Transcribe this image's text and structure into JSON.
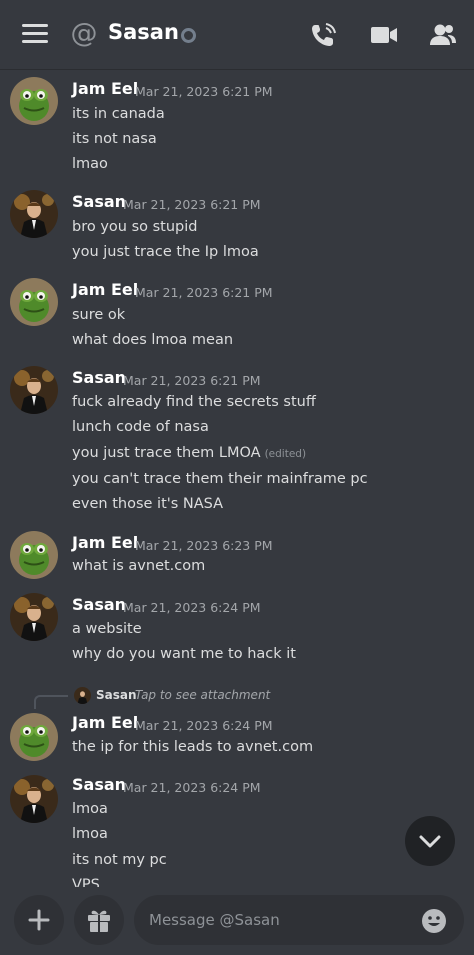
{
  "header": {
    "title": "Sasan",
    "at_symbol": "@"
  },
  "icons": {
    "menu": "hamburger-menu-icon",
    "dm": "at-sign-icon",
    "status": "offline-status-icon",
    "call": "phone-call-icon",
    "video": "video-camera-icon",
    "members": "members-icon",
    "scroll": "chevron-down-icon",
    "add": "plus-icon",
    "gift": "gift-icon",
    "emoji": "emoji-icon"
  },
  "colors": {
    "background": "#36393f",
    "input_bg": "#2f3136",
    "status_offline": "#747f8d",
    "text": "#dcddde",
    "muted": "#a3a6aa"
  },
  "messages": [
    {
      "author": "Jam Eel",
      "avatar": "kermit",
      "timestamp": "Mar 21, 2023 6:21 PM",
      "lines": [
        "its in canada",
        "its not nasa",
        "lmao"
      ]
    },
    {
      "author": "Sasan",
      "avatar": "gatsby",
      "timestamp": "Mar 21, 2023 6:21 PM",
      "lines": [
        "bro you so stupid",
        "you just trace the Ip lmoa"
      ]
    },
    {
      "author": "Jam Eel",
      "avatar": "kermit",
      "timestamp": "Mar 21, 2023 6:21 PM",
      "lines": [
        "sure ok",
        "what does lmoa mean"
      ]
    },
    {
      "author": "Sasan",
      "avatar": "gatsby",
      "timestamp": "Mar 21, 2023 6:21 PM",
      "lines": [
        "fuck already find the secrets stuff",
        "lunch code of nasa",
        "you just trace them LMOA",
        "you can't trace them their mainframe pc",
        "even those it's NASA"
      ],
      "edited_label": "(edited)"
    },
    {
      "author": "Jam Eel",
      "avatar": "kermit",
      "timestamp": "Mar 21, 2023 6:23 PM",
      "lines": [
        "what is avnet.com"
      ]
    },
    {
      "author": "Sasan",
      "avatar": "gatsby",
      "timestamp": "Mar 21, 2023 6:24 PM",
      "lines": [
        "a website",
        "why do you want me to hack it"
      ]
    },
    {
      "author": "Jam Eel",
      "avatar": "kermit",
      "timestamp": "Mar 21, 2023 6:24 PM",
      "lines": [
        "the ip for this leads to avnet.com"
      ]
    },
    {
      "author": "Sasan",
      "avatar": "gatsby",
      "timestamp": "Mar 21, 2023 6:24 PM",
      "lines": [
        "lmoa",
        "lmoa",
        "its not my pc",
        "VPS"
      ]
    }
  ],
  "reply": {
    "author": "Sasan",
    "text": "Tap to see attachment"
  },
  "composer": {
    "placeholder": "Message @Sasan"
  }
}
